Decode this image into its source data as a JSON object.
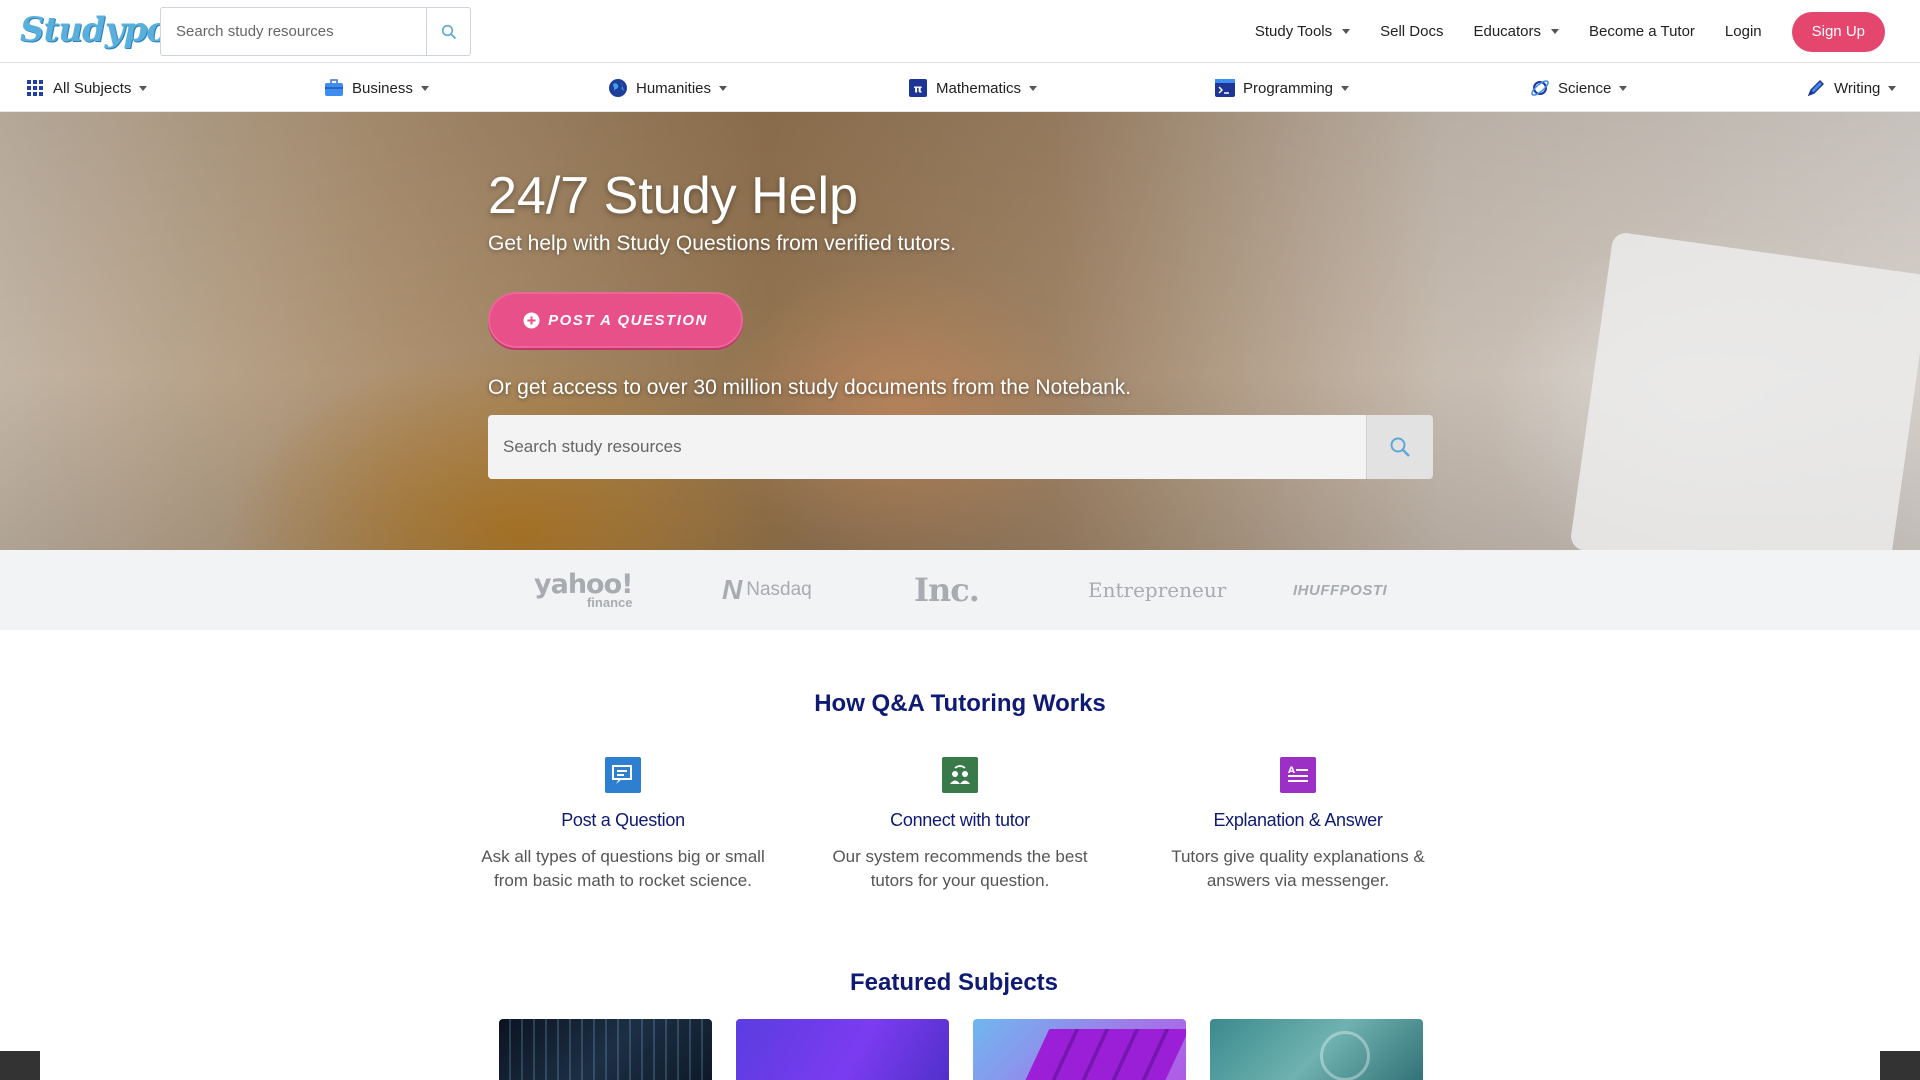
{
  "header": {
    "logo_text": "Studypool",
    "search_placeholder": "Search study resources",
    "nav": {
      "study_tools": "Study Tools",
      "sell_docs": "Sell Docs",
      "educators": "Educators",
      "become_tutor": "Become a Tutor",
      "login": "Login",
      "sign_up": "Sign Up"
    },
    "accent_color": "#e4466e"
  },
  "subjects": [
    {
      "label": "All Subjects",
      "icon": "grid-icon"
    },
    {
      "label": "Business",
      "icon": "briefcase-icon"
    },
    {
      "label": "Humanities",
      "icon": "globe-icon"
    },
    {
      "label": "Mathematics",
      "icon": "pi-icon"
    },
    {
      "label": "Programming",
      "icon": "terminal-icon"
    },
    {
      "label": "Science",
      "icon": "planet-icon"
    },
    {
      "label": "Writing",
      "icon": "pen-icon"
    }
  ],
  "hero": {
    "title": "24/7 Study Help",
    "subtitle": "Get help with Study Questions from verified tutors.",
    "post_button": "POST A QUESTION",
    "notebank_text": "Or get access to over 30 million study documents from the Notebank.",
    "search_placeholder": "Search study resources"
  },
  "press": {
    "yahoo": "yahoo!",
    "yahoo_sub": "finance",
    "nasdaq": "Nasdaq",
    "inc": "Inc.",
    "entrepreneur": "Entrepreneur",
    "huffpost": "IHUFFPOSTI"
  },
  "how_it_works": {
    "title": "How Q&A Tutoring Works",
    "steps": [
      {
        "title": "Post a Question",
        "desc1": "Ask all types of questions big or small",
        "desc2": "from basic math to rocket science.",
        "icon": "chat-icon",
        "color": "#2f7fd1"
      },
      {
        "title": "Connect with tutor",
        "desc1": "Our system recommends the best",
        "desc2": "tutors for your question.",
        "icon": "tutor-icon",
        "color": "#3a7a4a"
      },
      {
        "title": "Explanation & Answer",
        "desc1": "Tutors give quality explanations &",
        "desc2": "answers via messenger.",
        "icon": "answer-icon",
        "color": "#9b2fc6"
      }
    ]
  },
  "featured": {
    "title": "Featured Subjects"
  }
}
